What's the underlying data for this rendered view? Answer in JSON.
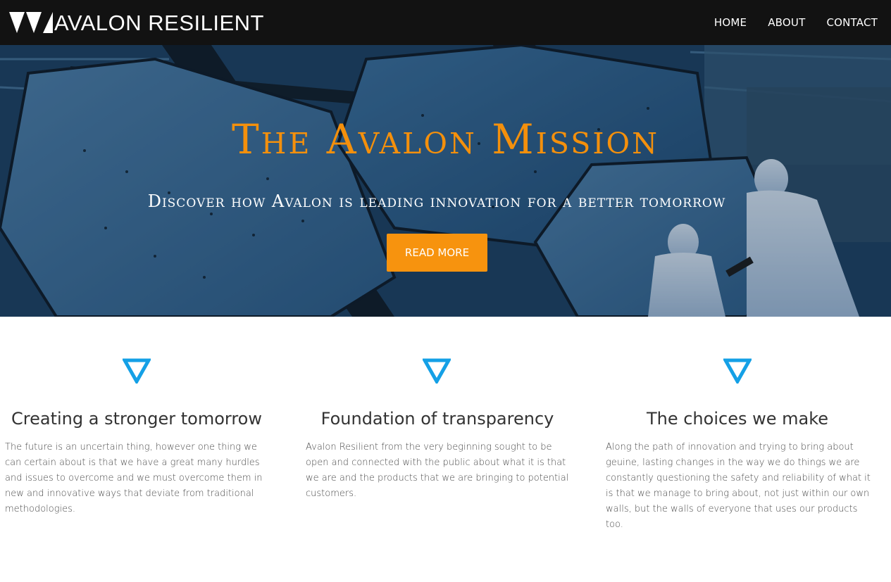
{
  "header": {
    "brand": "AVALON RESILIENT",
    "nav": [
      "HOME",
      "ABOUT",
      "CONTACT"
    ]
  },
  "hero": {
    "title": "The Avalon Mission",
    "subtitle": "Discover how Avalon is leading innovation for a better tomorrow",
    "button_label": "READ MORE"
  },
  "features": [
    {
      "icon": "triangle-down-icon",
      "title": "Creating a stronger tomorrow",
      "text": "The future is an uncertain thing, however one thing we can certain about is that we have a great many hurdles and issues to overcome and we must overcome them in new and innovative ways that deviate from traditional methodologies."
    },
    {
      "icon": "triangle-down-icon",
      "title": "Foundation of transparency",
      "text": "Avalon Resilient from the very beginning sought to be open and connected with the public about what it is that we are and the products that we are bringing to potential customers."
    },
    {
      "icon": "triangle-down-icon",
      "title": "The choices we make",
      "text": "Along the path of innovation and trying to bring about geuine, lasting changes in the way we do things we are constantly questioning the safety and reliability of what it is that we manage to bring about, not just within our own walls, but the walls of everyone that uses our products too."
    }
  ],
  "colors": {
    "header_bg": "#121212",
    "accent_orange": "#f7930e",
    "icon_blue": "#14a0e6"
  }
}
